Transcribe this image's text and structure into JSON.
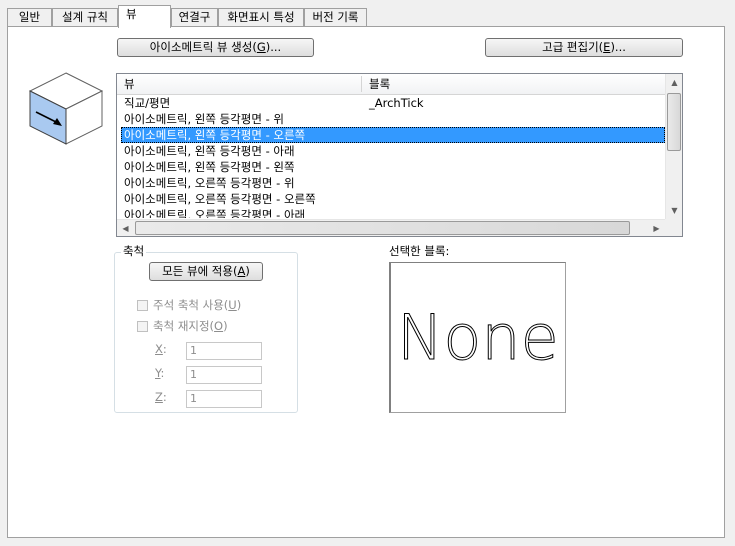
{
  "tabs": [
    "일반",
    "설계 규칙",
    "뷰",
    "연결구",
    "화면표시 특성",
    "버전 기록"
  ],
  "active_tab": "뷰",
  "buttons": {
    "create_iso_view": "아이소메트릭 뷰 생성(G)...",
    "advanced_editor": "고급 편집기(E)...",
    "apply_all_views": "모든 뷰에 적용(A)"
  },
  "list": {
    "columns": [
      "뷰",
      "블록"
    ],
    "rows": [
      {
        "view": "직교/평면",
        "block": "_ArchTick"
      },
      {
        "view": "아이소메트릭, 왼쪽 등각평면 - 위",
        "block": ""
      },
      {
        "view": "아이소메트릭, 왼쪽 등각평면 - 오른쪽",
        "block": "",
        "selected": true
      },
      {
        "view": "아이소메트릭, 왼쪽 등각평면 - 아래",
        "block": ""
      },
      {
        "view": "아이소메트릭, 왼쪽 등각평면 - 왼쪽",
        "block": ""
      },
      {
        "view": "아이소메트릭, 오른쪽 등각평면 - 위",
        "block": ""
      },
      {
        "view": "아이소메트릭, 오른쪽 등각평면 - 오른쪽",
        "block": ""
      },
      {
        "view": "아이소메트릭, 오른쪽 등각평면 - 아래",
        "block": ""
      }
    ]
  },
  "scale": {
    "title": "축척",
    "annotative_label": "주석 축척 사용(U)",
    "override_label": "축척 재지정(O)",
    "x_label": "X:",
    "y_label": "Y:",
    "z_label": "Z:",
    "x_value": "1",
    "y_value": "1",
    "z_value": "1"
  },
  "selected_block": {
    "title": "선택한 블록:",
    "preview_text": "None"
  },
  "colors": {
    "selection": "#3399ff",
    "cube_face": "#a9c9f0"
  }
}
